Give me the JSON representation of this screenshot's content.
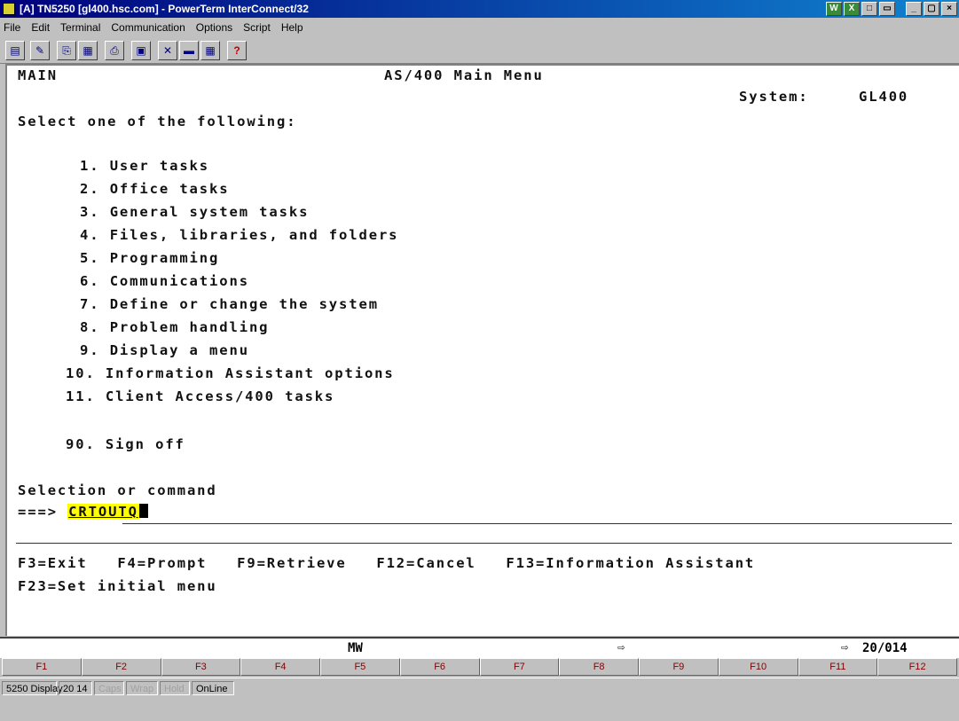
{
  "window": {
    "title": "[A] TN5250 [gl400.hsc.com] - PowerTerm InterConnect/32",
    "title_buttons": [
      "W",
      "X",
      "□",
      "▭",
      "_",
      "▢",
      "×"
    ]
  },
  "menu": [
    "File",
    "Edit",
    "Terminal",
    "Communication",
    "Options",
    "Script",
    "Help"
  ],
  "toolbar": {
    "icons": [
      "print-icon",
      "edit-icon",
      "copy-icon",
      "paste-icon",
      "printer-icon",
      "screen-icon",
      "tools-icon",
      "keyboard-icon",
      "grid-icon",
      "help-icon"
    ],
    "help_label": "?"
  },
  "screen": {
    "menu_id": "MAIN",
    "title": "AS/400 Main Menu",
    "system_label": "System:",
    "system_value": "GL400",
    "prompt": "Select one of the following:",
    "options": [
      "1. User tasks",
      "2. Office tasks",
      "3. General system tasks",
      "4. Files, libraries, and folders",
      "5. Programming",
      "6. Communications",
      "7. Define or change the system",
      "8. Problem handling",
      "9. Display a menu",
      "10. Information Assistant options",
      "11. Client Access/400 tasks"
    ],
    "signoff": "90. Sign off",
    "selection_label": "Selection or command",
    "command_arrow": "===>",
    "command_value": "CRTOUTQ",
    "fkeys_line1": "F3=Exit   F4=Prompt   F9=Retrieve   F12=Cancel   F13=Information Assistant",
    "fkeys_line2": "F23=Set initial menu"
  },
  "status_line": {
    "mode": "MW",
    "arrow": "⇨",
    "position_arrow": "⇨",
    "position": "20/014"
  },
  "function_keys": [
    "F1",
    "F2",
    "F3",
    "F4",
    "F5",
    "F6",
    "F7",
    "F8",
    "F9",
    "F10",
    "F11",
    "F12"
  ],
  "status_bar": {
    "display": "5250 Display",
    "pos": "20 14",
    "caps": "Caps",
    "wrap": "Wrap",
    "hold": "Hold",
    "online": "OnLine"
  },
  "colors": {
    "title_bar": "#00007b",
    "highlight": "#ffff00",
    "fkey_text": "#800000"
  }
}
